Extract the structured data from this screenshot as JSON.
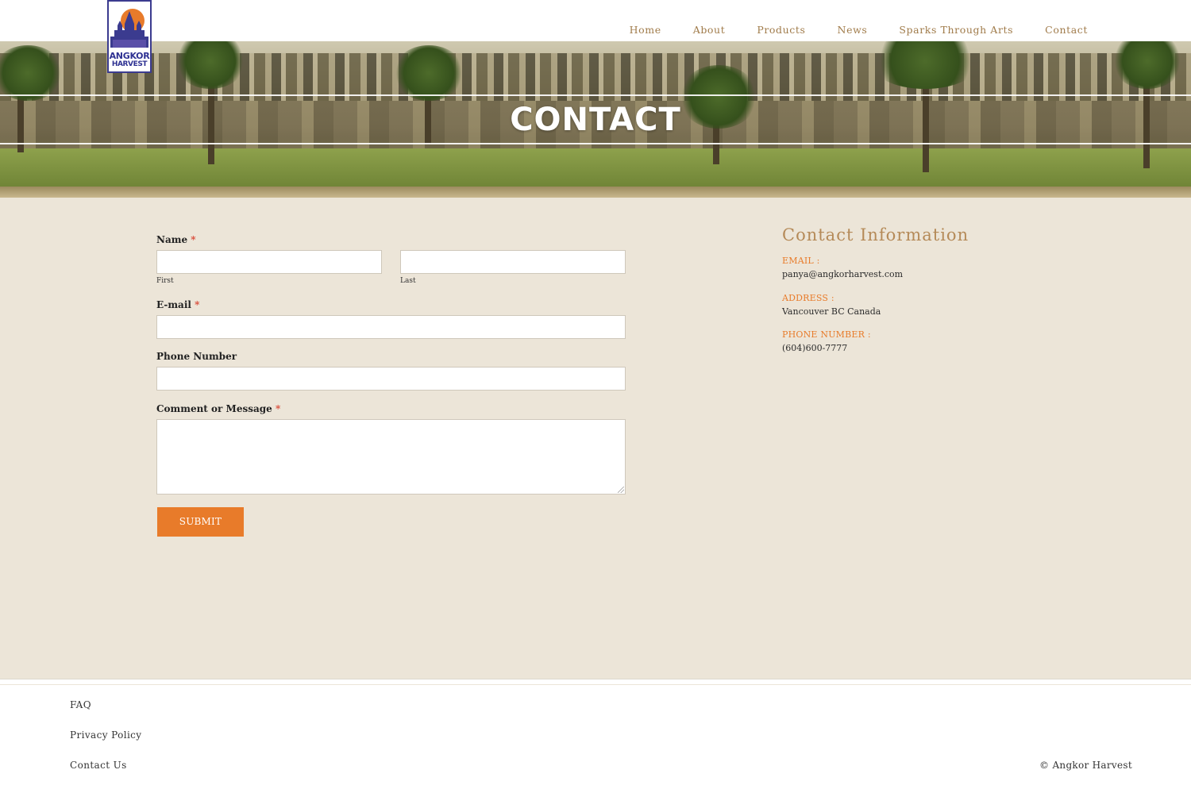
{
  "brand": {
    "logo_line1": "ANGKOR",
    "logo_line2": "HARVEST",
    "colors": {
      "accent": "#e87b2a",
      "heading": "#b58a58",
      "nav": "#a07b4a",
      "logo_blue": "#2e3192"
    }
  },
  "nav": {
    "items": [
      {
        "label": "Home"
      },
      {
        "label": "About"
      },
      {
        "label": "Products"
      },
      {
        "label": "News"
      },
      {
        "label": "Sparks Through Arts"
      },
      {
        "label": "Contact"
      }
    ]
  },
  "hero": {
    "title": "CONTACT"
  },
  "form": {
    "name_label": "Name",
    "required_mark": "*",
    "first_sublabel": "First",
    "last_sublabel": "Last",
    "email_label": "E-mail",
    "phone_label": "Phone Number",
    "message_label": "Comment or Message",
    "submit_label": "SUBMIT"
  },
  "contact_info": {
    "title": "Contact Information",
    "email_label": "EMAIL :",
    "email_value": "panya@angkorharvest.com",
    "address_label": "ADDRESS :",
    "address_value": "Vancouver BC Canada",
    "phone_label": "PHONE NUMBER :",
    "phone_value": "(604)600-7777"
  },
  "footer": {
    "links": [
      {
        "label": "FAQ"
      },
      {
        "label": "Privacy Policy"
      },
      {
        "label": "Contact Us"
      }
    ],
    "copyright": "© Angkor Harvest"
  }
}
